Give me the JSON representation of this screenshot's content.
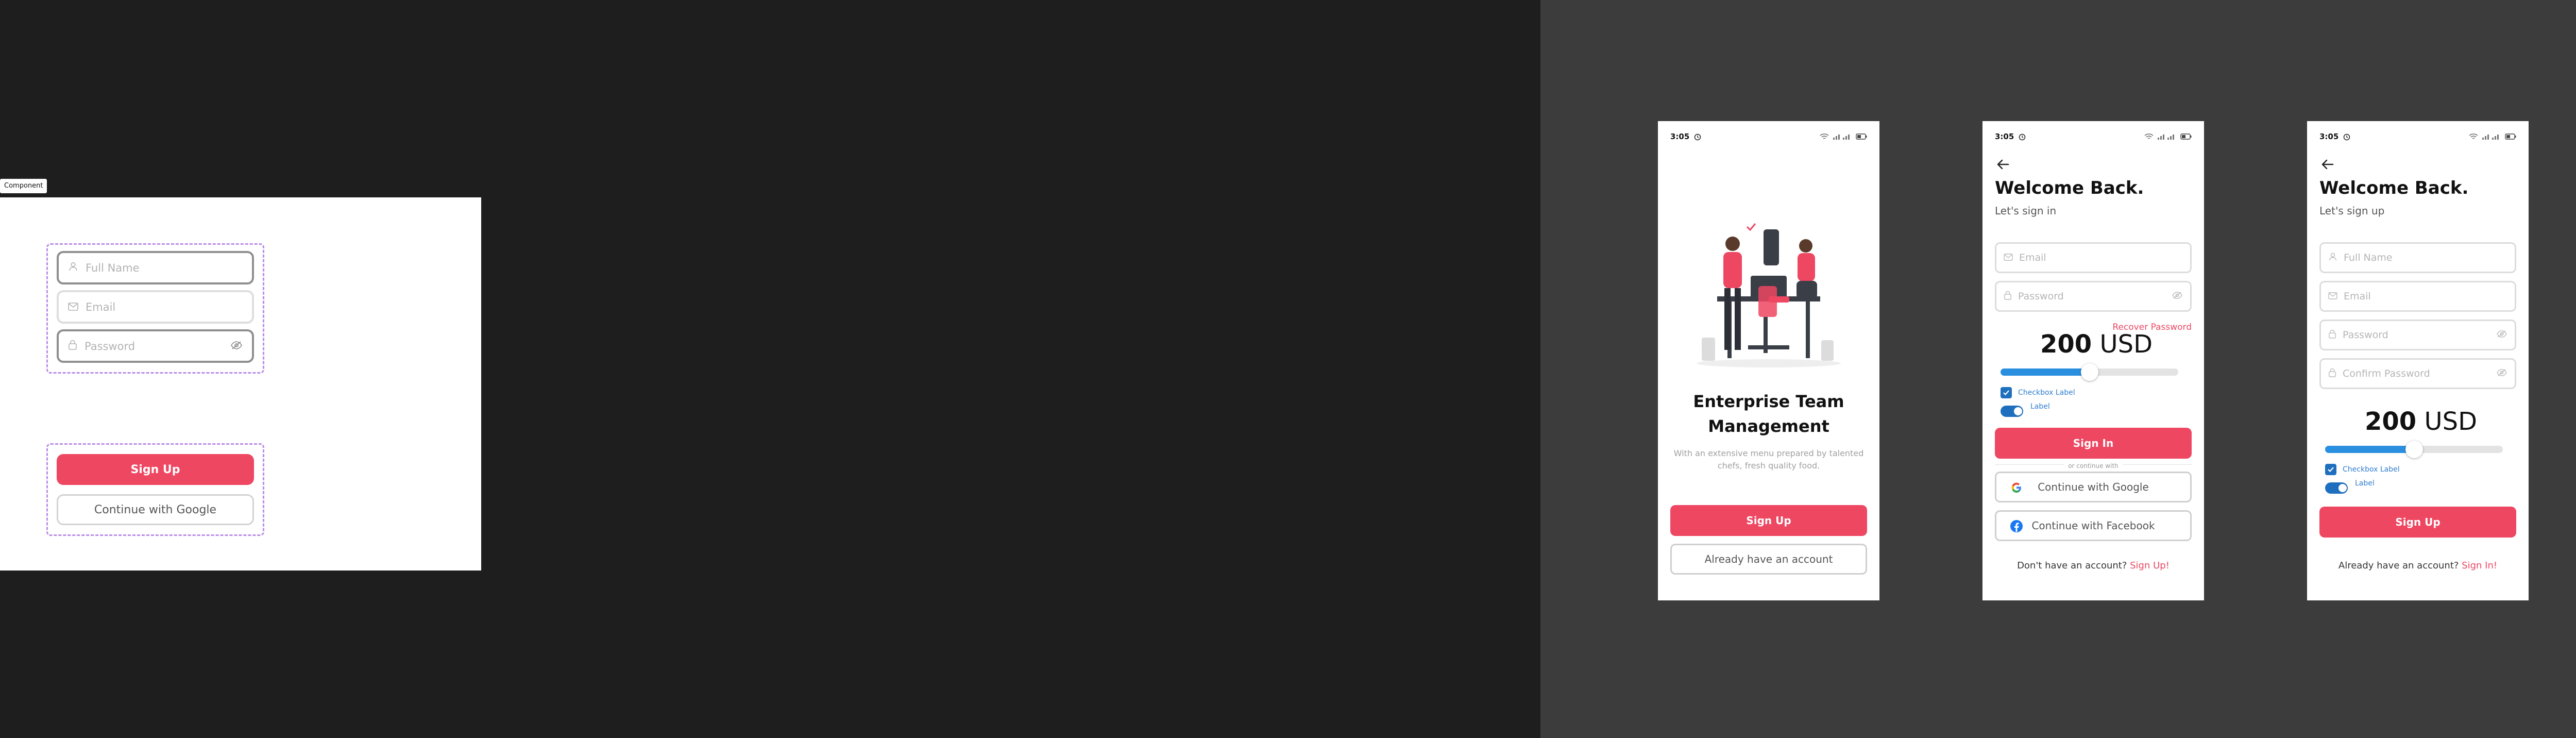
{
  "component_panel": {
    "tag": "Component",
    "fields": [
      {
        "label": "Full Name",
        "icon": "user-icon"
      },
      {
        "label": "Email",
        "icon": "mail-icon"
      },
      {
        "label": "Password",
        "icon": "lock-icon"
      }
    ],
    "sign_up_label": "Sign Up",
    "google_label": "Continue with Google"
  },
  "screen_onboarding": {
    "time": "3:05",
    "title_line1": "Enterprise Team",
    "title_line2": "Management",
    "description_line1": "With an extensive menu prepared by talented",
    "description_line2": "chefs, fresh quality food.",
    "sign_up_label": "Sign Up",
    "account_label": "Already have an account"
  },
  "screen_signin": {
    "time": "3:05",
    "title": "Welcome Back.",
    "subtitle": "Let's sign in",
    "email_placeholder": "Email",
    "password_placeholder": "Password",
    "recover_label": "Recover Password",
    "amount": {
      "value": "200",
      "currency": "USD",
      "slider_fraction": 0.5
    },
    "checkbox_label": "Checkbox Label",
    "toggle_label": "Label",
    "sign_in_label": "Sign In",
    "divider_text": "or continue with",
    "google_label": "Continue with Google",
    "facebook_label": "Continue with Facebook",
    "footer_text": "Don't have an account?",
    "footer_link": "Sign Up!"
  },
  "screen_signup": {
    "time": "3:05",
    "title": "Welcome Back.",
    "subtitle": "Let's sign up",
    "fields": [
      "Full Name",
      "Email",
      "Password",
      "Confirm Password"
    ],
    "amount": {
      "value": "200",
      "currency": "USD",
      "slider_fraction": 0.5
    },
    "checkbox_label": "Checkbox Label",
    "toggle_label": "Label",
    "sign_up_label": "Sign Up",
    "footer_text": "Already have an account?",
    "footer_link": "Sign In!"
  },
  "colors": {
    "accent": "#ee4762",
    "slider": "#2b8fe0",
    "canvas_left": "#1e1e1e",
    "canvas_right": "#3c3c3c",
    "selection_dash": "#b98de8"
  }
}
